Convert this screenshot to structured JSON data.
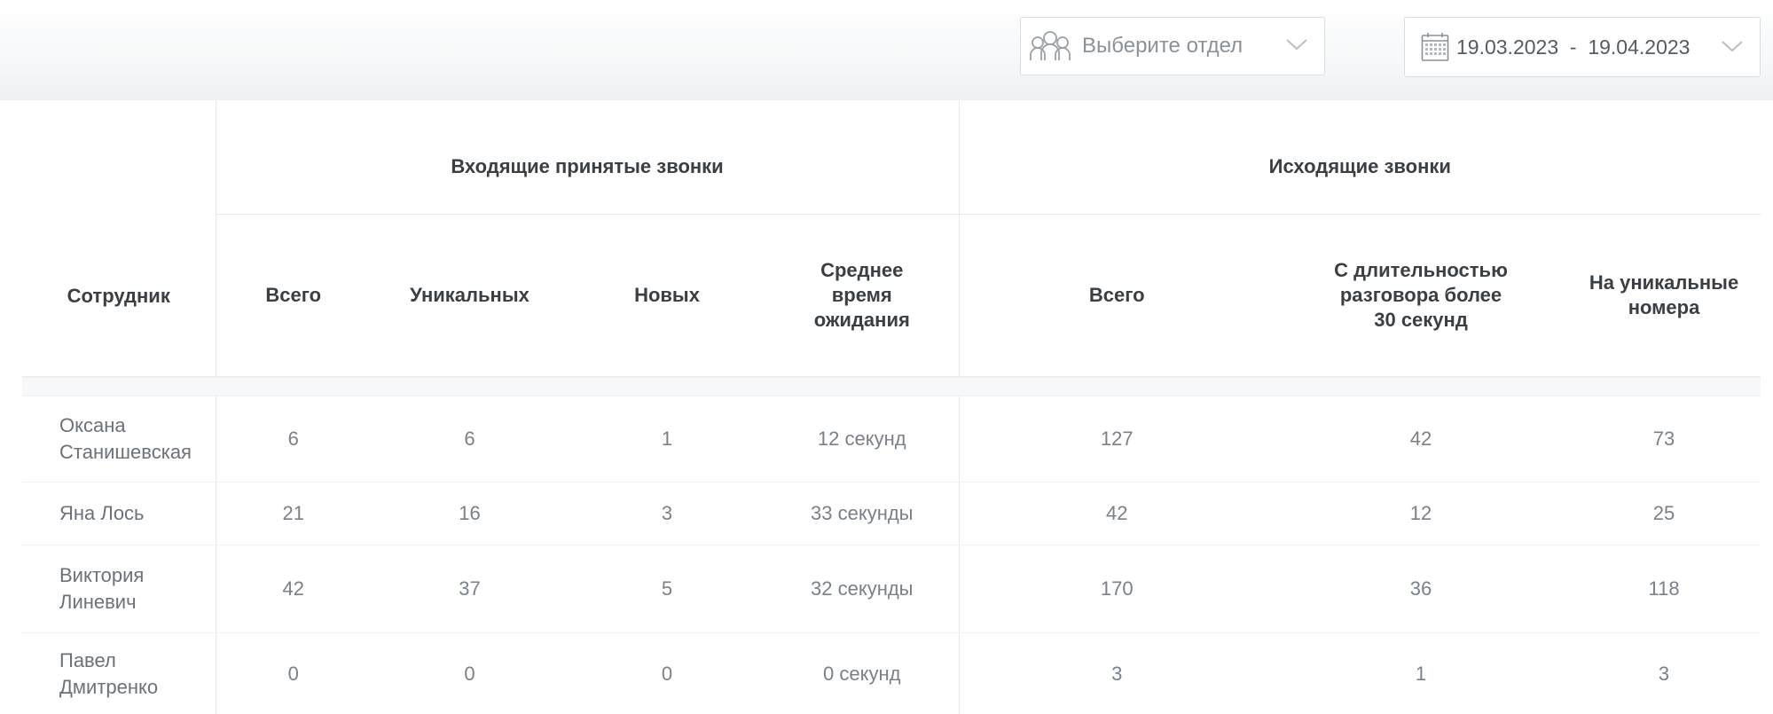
{
  "filters": {
    "department": {
      "placeholder": "Выберите отдел",
      "icon": "people-group-icon"
    },
    "date_range": {
      "value": "19.03.2023  -  19.04.2023",
      "icon": "calendar-icon"
    }
  },
  "table": {
    "employee_header": "Сотрудник",
    "groups": {
      "incoming": "Входящие принятые звонки",
      "outgoing": "Исходящие звонки"
    },
    "incoming_columns": [
      "Всего",
      "Уникальных",
      "Новых",
      "Среднее время ожидания"
    ],
    "outgoing_columns": [
      "Всего",
      "С длительностью разговора более 30 секунд",
      "На уникальные номера"
    ],
    "rows": [
      {
        "name": "Оксана Станишевская",
        "cells": [
          "6",
          "6",
          "1",
          "12 секунд",
          "127",
          "42",
          "73"
        ]
      },
      {
        "name": "Яна Лось",
        "cells": [
          "21",
          "16",
          "3",
          "33 секунды",
          "42",
          "12",
          "25"
        ]
      },
      {
        "name": "Виктория Линевич",
        "cells": [
          "42",
          "37",
          "5",
          "32 секунды",
          "170",
          "36",
          "118"
        ]
      },
      {
        "name": "Павел Дмитренко",
        "cells": [
          "0",
          "0",
          "0",
          "0 секунд",
          "3",
          "1",
          "3"
        ]
      }
    ]
  }
}
